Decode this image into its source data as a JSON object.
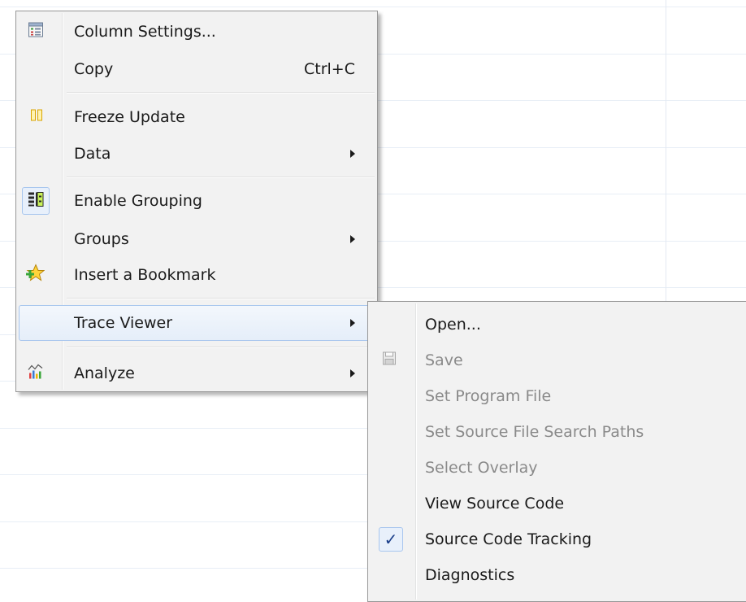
{
  "context_menu": {
    "items": [
      {
        "label": "Column Settings...",
        "icon": "column-settings-icon"
      },
      {
        "label": "Copy",
        "shortcut": "Ctrl+C"
      },
      {
        "label": "Freeze Update",
        "icon": "pause-icon"
      },
      {
        "label": "Data",
        "has_submenu": true
      },
      {
        "label": "Enable Grouping",
        "icon": "grouping-icon",
        "checked": true
      },
      {
        "label": "Groups",
        "has_submenu": true
      },
      {
        "label": "Insert a Bookmark",
        "icon": "bookmark-star-icon"
      },
      {
        "label": "Trace Viewer",
        "has_submenu": true,
        "highlighted": true
      },
      {
        "label": "Analyze",
        "icon": "analyze-chart-icon",
        "has_submenu": true
      }
    ]
  },
  "trace_viewer_submenu": {
    "items": [
      {
        "label": "Open...",
        "enabled": true
      },
      {
        "label": "Save",
        "enabled": false,
        "icon": "save-disk-icon"
      },
      {
        "label": "Set Program File",
        "enabled": false
      },
      {
        "label": "Set Source File Search Paths",
        "enabled": false
      },
      {
        "label": "Select Overlay",
        "enabled": false
      },
      {
        "label": "View Source Code",
        "enabled": true
      },
      {
        "label": "Source Code Tracking",
        "enabled": true,
        "checked": true
      },
      {
        "label": "Diagnostics",
        "enabled": true
      }
    ],
    "check_glyph": "✓"
  },
  "colors": {
    "menu_bg": "#f2f2f2",
    "highlight_border": "#a8c6ee",
    "disabled_text": "#8a8a8a",
    "check_color": "#1b3f8a"
  }
}
